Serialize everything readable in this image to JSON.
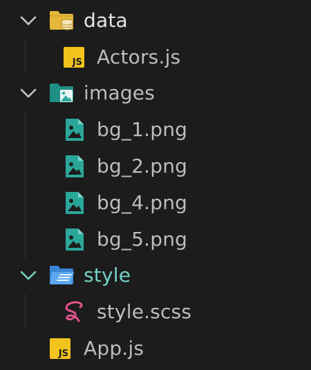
{
  "explorer": {
    "folders": {
      "data": {
        "label": "data"
      },
      "images": {
        "label": "images"
      },
      "style": {
        "label": "style"
      }
    },
    "files": {
      "actors": {
        "label": "Actors.js",
        "badge": "JS"
      },
      "bg1": {
        "label": "bg_1.png"
      },
      "bg2": {
        "label": "bg_2.png"
      },
      "bg4": {
        "label": "bg_4.png"
      },
      "bg5": {
        "label": "bg_5.png"
      },
      "scss": {
        "label": "style.scss"
      },
      "app": {
        "label": "App.js",
        "badge": "JS"
      }
    }
  },
  "colors": {
    "background": "#1c1c1c",
    "folder_yellow": "#e5b73a",
    "image_teal": "#2aa79a",
    "folder_blue": "#4a9ce8",
    "sass_pink": "#e0568c",
    "js_yellow": "#f2c31d",
    "style_label": "#74d3c7"
  },
  "icons": {
    "data": "folder-database-icon",
    "images": "folder-images-icon",
    "style": "folder-style-icon",
    "js": "javascript-file-icon",
    "image": "image-file-icon",
    "sass": "sass-file-icon"
  }
}
